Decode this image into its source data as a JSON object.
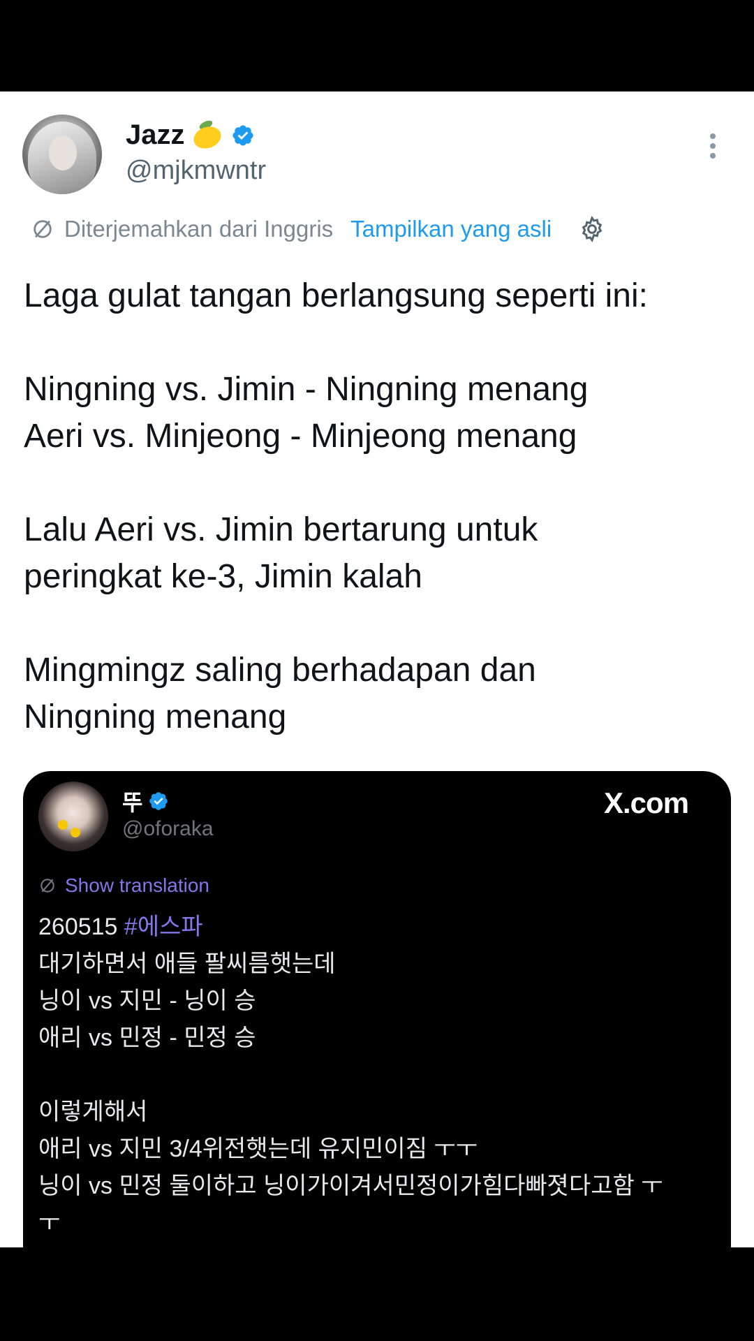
{
  "author": {
    "display_name": "Jazz",
    "handle": "@mjkmwntr",
    "emoji_icon": "lemon-icon",
    "verified": true
  },
  "translation_bar": {
    "translated_from": "Diterjemahkan dari Inggris",
    "show_original": "Tampilkan yang asli"
  },
  "tweet_text": [
    "Laga gulat tangan berlangsung seperti ini:",
    "",
    "Ningning vs. Jimin - Ningning menang",
    "Aeri vs. Minjeong - Minjeong menang",
    "",
    "Lalu Aeri vs. Jimin bertarung untuk",
    "peringkat ke-3, Jimin kalah",
    "",
    "Mingmingz saling berhadapan dan",
    "Ningning menang"
  ],
  "quoted": {
    "display_name": "뚜",
    "handle": "@oforaka",
    "site": "X.com",
    "show_translation": "Show translation",
    "first_line_date": "260515",
    "first_line_hashtag": "#에스파",
    "lines": [
      "대기하면서 애들 팔씨름햇는데",
      "닝이 vs 지민 - 닝이 승",
      "애리 vs 민정 - 민정 승",
      "",
      "이렇게해서",
      "애리 vs 지민 3/4위전햇는데 유지민이짐 ㅜㅜ",
      "닝이 vs 민정 둘이하고 닝이가이겨서민정이가힘다빠졋다고함 ㅜ",
      "ㅜ"
    ]
  },
  "colors": {
    "link_blue": "#1d9bf0",
    "quote_link_purple": "#8177e8",
    "verified_blue": "#1d9bf0"
  }
}
